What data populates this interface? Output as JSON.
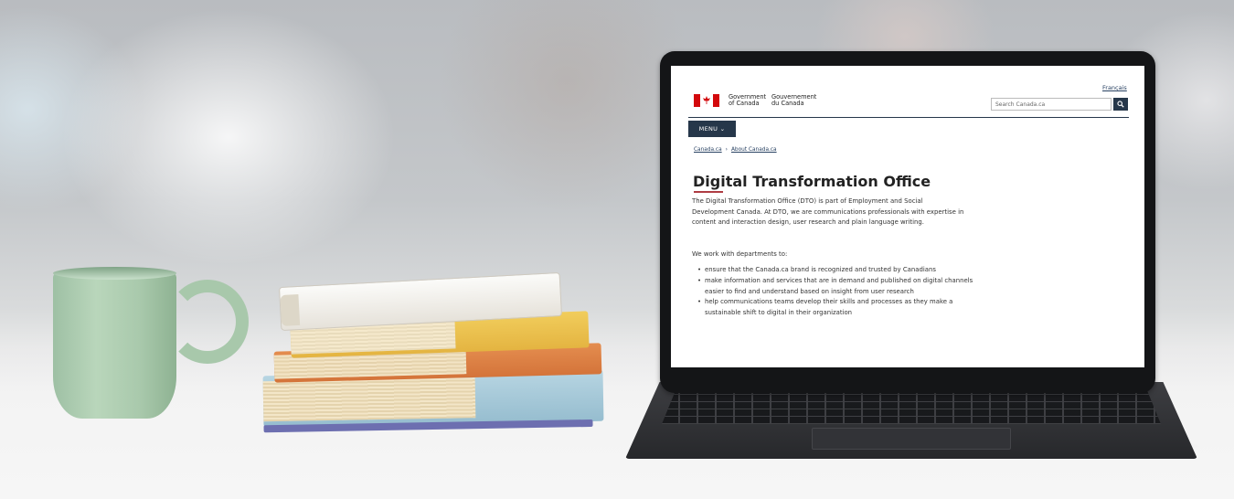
{
  "site": {
    "lang_toggle": "Français",
    "signature_en": [
      "Government",
      "of Canada"
    ],
    "signature_fr": [
      "Gouvernement",
      "du Canada"
    ],
    "search_placeholder": "Search Canada.ca",
    "search_icon": "search-icon",
    "menu_label": "MENU"
  },
  "breadcrumb": [
    "Canada.ca",
    "About Canada.ca"
  ],
  "page": {
    "title": "Digital Transformation Office",
    "intro": "The Digital Transformation Office (DTO) is part of Employment and Social Development Canada. At DTO, we are communications professionals with expertise in content and interaction design, user research and plain language writing.",
    "list_intro": "We work with departments to:",
    "items": [
      "ensure that the Canada.ca brand is recognized and trusted by Canadians",
      "make information and services that are in demand and published on digital channels easier to find and understand based on insight from user research",
      "help communications teams develop their skills and processes as they make a sustainable shift to digital in their organization"
    ]
  },
  "colors": {
    "gc_blue": "#26374a",
    "gc_red": "#d3080c",
    "title_bar": "#af3c43",
    "link": "#284162"
  }
}
